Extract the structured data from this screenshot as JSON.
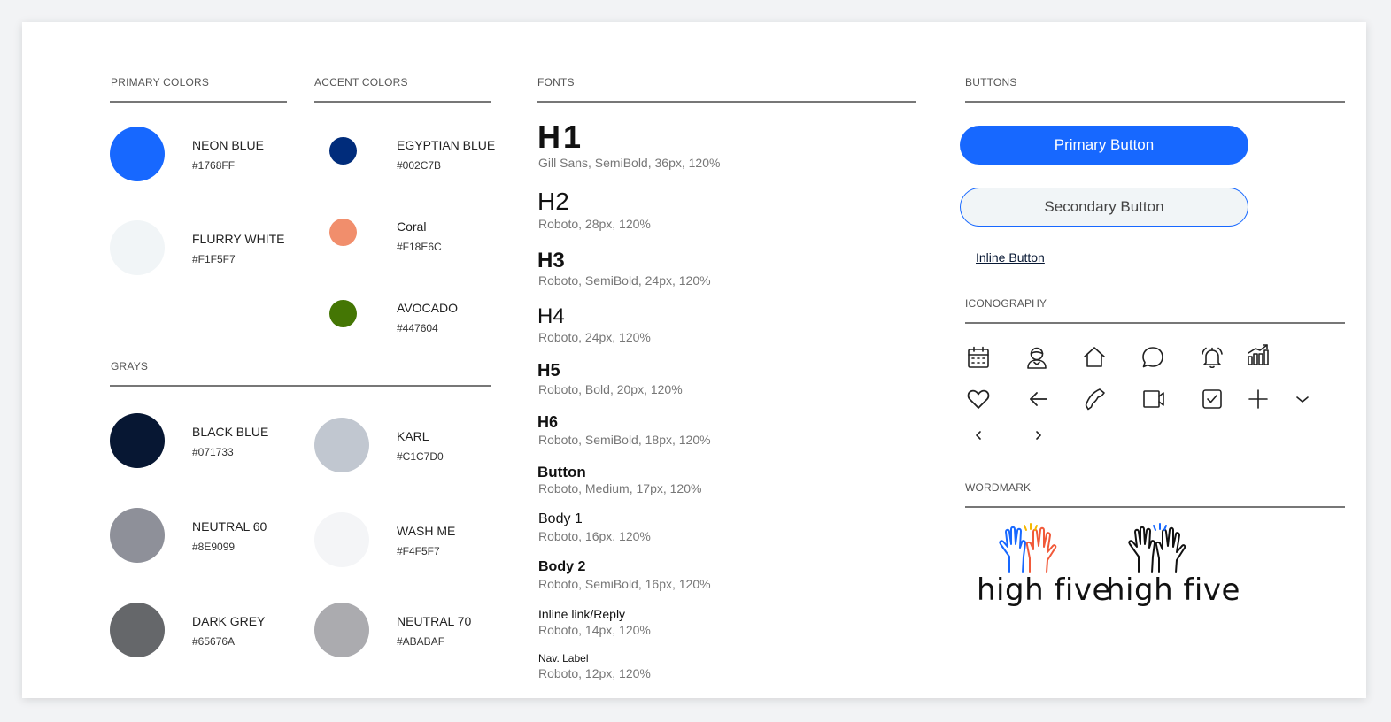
{
  "colors": {
    "primary_title": "PRIMARY COLORS",
    "accent_title": "ACCENT COLORS",
    "grays_title": "GRAYS",
    "primary": [
      {
        "name": "NEON BLUE",
        "hex": "#1768FF",
        "color": "#1768ff"
      },
      {
        "name": "FLURRY WHITE",
        "hex": "#F1F5F7",
        "color": "#f1f5f7"
      }
    ],
    "accent": [
      {
        "name": "EGYPTIAN BLUE",
        "hex": "#002C7B",
        "color": "#002c7b"
      },
      {
        "name": "Coral",
        "hex": "#F18E6C",
        "color": "#f18e6c"
      },
      {
        "name": "AVOCADO",
        "hex": "#447604",
        "color": "#447604"
      }
    ],
    "grays": [
      {
        "name": "BLACK BLUE",
        "hex": "#071733",
        "color": "#071733"
      },
      {
        "name": "KARL",
        "hex": "#C1C7D0",
        "color": "#c1c7d0"
      },
      {
        "name": "NEUTRAL 60",
        "hex": "#8E9099",
        "color": "#8e9099"
      },
      {
        "name": "WASH ME",
        "hex": "#F4F5F7",
        "color": "#f4f5f7"
      },
      {
        "name": "DARK GREY",
        "hex": "#65676A",
        "color": "#65676a"
      },
      {
        "name": "NEUTRAL 70",
        "hex": "#ABABAF",
        "color": "#ababaf"
      }
    ]
  },
  "fonts": {
    "title": "FONTS",
    "items": [
      {
        "label": "H1",
        "desc": "Gill Sans, SemiBold, 36px, 120%"
      },
      {
        "label": "H2",
        "desc": "Roboto, 28px, 120%"
      },
      {
        "label": "H3",
        "desc": "Roboto, SemiBold, 24px, 120%"
      },
      {
        "label": "H4",
        "desc": "Roboto, 24px, 120%"
      },
      {
        "label": "H5",
        "desc": "Roboto, Bold, 20px, 120%"
      },
      {
        "label": "H6",
        "desc": "Roboto, SemiBold, 18px, 120%"
      },
      {
        "label": "Button",
        "desc": "Roboto, Medium, 17px, 120%"
      },
      {
        "label": "Body 1",
        "desc": "Roboto, 16px, 120%"
      },
      {
        "label": "Body 2",
        "desc": "Roboto, SemiBold, 16px, 120%"
      },
      {
        "label": "Inline link/Reply",
        "desc": "Roboto, 14px, 120%"
      },
      {
        "label": "Nav. Label",
        "desc": "Roboto, 12px, 120%"
      }
    ]
  },
  "buttons": {
    "title": "BUTTONS",
    "primary_label": "Primary Button",
    "secondary_label": "Secondary Button",
    "inline_label": "Inline Button"
  },
  "iconography": {
    "title": "ICONOGRAPHY",
    "icons": [
      "calendar-icon",
      "user-icon",
      "home-icon",
      "chat-icon",
      "bell-icon",
      "chart-icon",
      "heart-icon",
      "arrow-left-icon",
      "phone-icon",
      "video-icon",
      "checkbox-icon",
      "plus-icon",
      "chevron-down-icon",
      "chevron-left-icon",
      "chevron-right-icon"
    ]
  },
  "wordmark": {
    "title": "WORDMARK",
    "text": "high five",
    "accent_blue": "#1768ff",
    "accent_coral": "#f15a3a",
    "accent_yellow": "#f5b800"
  }
}
